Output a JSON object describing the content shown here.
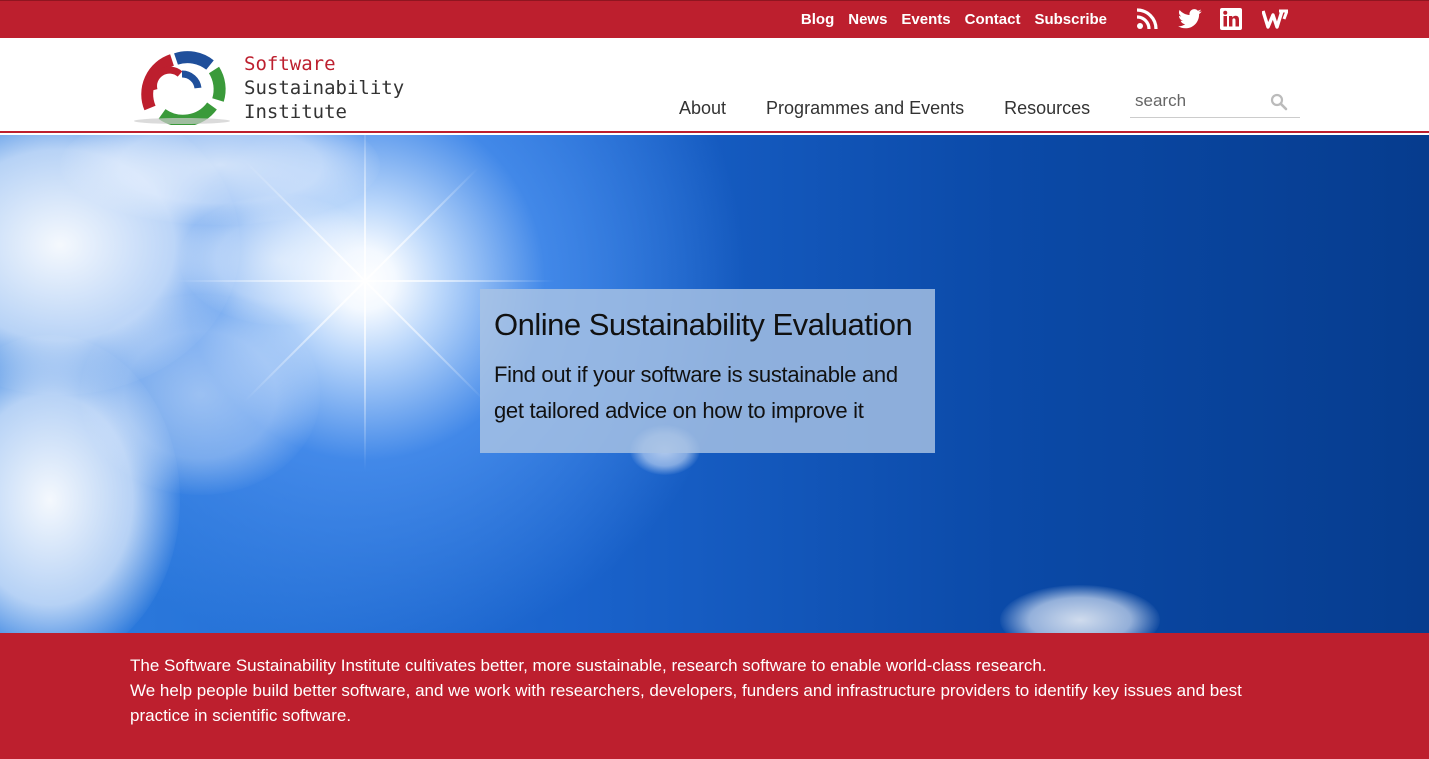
{
  "topbar": {
    "links": [
      "Blog",
      "News",
      "Events",
      "Contact",
      "Subscribe"
    ],
    "social_icons": [
      "rss-icon",
      "twitter-icon",
      "linkedin-icon",
      "w-icon"
    ]
  },
  "header": {
    "logo": {
      "line1": "Software",
      "line2": "Sustainability",
      "line3": "Institute"
    },
    "nav": [
      "About",
      "Programmes and Events",
      "Resources"
    ],
    "search": {
      "placeholder": "search"
    }
  },
  "hero": {
    "title": "Online Sustainability Evaluation",
    "subtitle": "Find out if your software is sustainable and get tailored advice on how to improve it"
  },
  "band": {
    "line1": "The Software Sustainability Institute cultivates better, more sustainable, research software to enable world-class research.",
    "line2": "We help people build better software, and we work with researchers, developers, funders and infrastructure providers to identify key issues and best practice in scientific software."
  },
  "colors": {
    "brand_red": "#bd1f2e",
    "sky_blue": "#1a63cc"
  }
}
